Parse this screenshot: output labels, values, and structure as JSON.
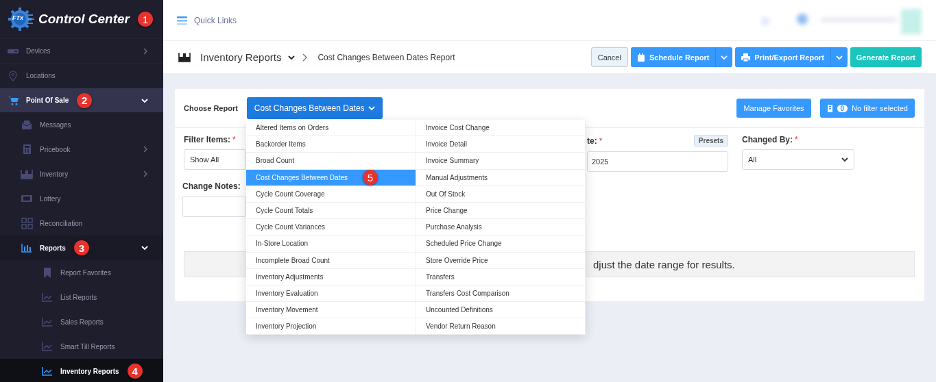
{
  "sidebar": {
    "logo": {
      "mark": "FTx",
      "text": "Control Center",
      "badge": "1"
    },
    "items": [
      {
        "label": "Devices",
        "expanded": false,
        "selected": false
      },
      {
        "label": "Locations",
        "selected": false
      },
      {
        "label": "Point Of Sale",
        "expanded": true,
        "selected": false,
        "badge": "2",
        "children": [
          {
            "label": "Messages",
            "selected": false
          },
          {
            "label": "Pricebook",
            "expanded": false,
            "selected": false
          },
          {
            "label": "Inventory",
            "expanded": false,
            "selected": false
          },
          {
            "label": "Lottery",
            "selected": false
          },
          {
            "label": "Reconciliation",
            "selected": false
          },
          {
            "label": "Reports",
            "expanded": true,
            "selected": false,
            "badge": "3",
            "children": [
              {
                "label": "Report Favorites",
                "selected": false
              },
              {
                "label": "List Reports",
                "selected": false
              },
              {
                "label": "Sales Reports",
                "selected": false
              },
              {
                "label": "Smart Till Reports",
                "selected": false
              },
              {
                "label": "Inventory Reports",
                "selected": true,
                "badge": "4"
              }
            ]
          }
        ]
      }
    ]
  },
  "top_bar": {
    "quick_links": "Quick Links"
  },
  "breadcrumb": {
    "section": "Inventory Reports",
    "page": "Cost Changes Between Dates Report"
  },
  "actions": [
    {
      "label": "Cancel",
      "kind": "plain"
    },
    {
      "label": "Schedule Report",
      "kind": "schedule"
    },
    {
      "label": "Print/Export Report",
      "kind": "print"
    },
    {
      "label": "Generate Report",
      "kind": "primary"
    }
  ],
  "report_picker": {
    "label": "Choose Report",
    "value": "Cost Changes Between Dates",
    "expanded": true,
    "items": [
      {
        "label": "Altered Items on Orders",
        "selected": false
      },
      {
        "label": "Backorder Items",
        "selected": false
      },
      {
        "label": "Broad Count",
        "selected": false
      },
      {
        "label": "Cost Changes Between Dates",
        "selected": true,
        "badge": "5"
      },
      {
        "label": "Cycle Count Coverage",
        "selected": false
      },
      {
        "label": "Cycle Count Totals",
        "selected": false
      },
      {
        "label": "Cycle Count Variances",
        "selected": false
      },
      {
        "label": "In-Store Location",
        "selected": false
      },
      {
        "label": "Incomplete Broad Count",
        "selected": false
      },
      {
        "label": "Inventory Adjustments",
        "selected": false
      },
      {
        "label": "Inventory Evaluation",
        "selected": false
      },
      {
        "label": "Inventory Movement",
        "selected": false
      },
      {
        "label": "Inventory Projection",
        "selected": false
      },
      {
        "label": "Invoice Cost Change",
        "selected": false
      },
      {
        "label": "Invoice Detail",
        "selected": false
      },
      {
        "label": "Invoice Summary",
        "selected": false
      },
      {
        "label": "Manual Adjustments",
        "selected": false
      },
      {
        "label": "Out Of Stock",
        "selected": false
      },
      {
        "label": "Price Change",
        "selected": false
      },
      {
        "label": "Purchase Analysis",
        "selected": false
      },
      {
        "label": "Scheduled Price Change",
        "selected": false
      },
      {
        "label": "Store Override Price",
        "selected": false
      },
      {
        "label": "Transfers",
        "selected": false
      },
      {
        "label": "Transfers Cost Comparison",
        "selected": false
      },
      {
        "label": "Uncounted Definitions",
        "selected": false
      },
      {
        "label": "Vendor Return Reason",
        "selected": false
      }
    ]
  },
  "manage_favorites": "Manage Favorites",
  "filter": {
    "count": "0",
    "status": "No filter selected"
  },
  "fields": {
    "filter_items": {
      "label": "Filter Items:",
      "required_mark": "*",
      "value": "Show All"
    },
    "date": {
      "label": "te:",
      "required_mark": "*",
      "presets": "Presets",
      "value": "2025"
    },
    "changed_by": {
      "label": "Changed By:",
      "required_mark": "*",
      "value": "All"
    },
    "change_notes": {
      "label": "Change Notes:"
    }
  },
  "message": "djust the date range for results."
}
